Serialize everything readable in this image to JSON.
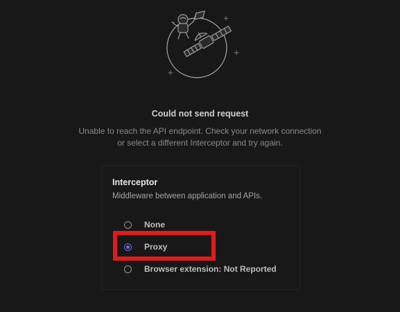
{
  "error": {
    "title": "Could not send request",
    "message_line1": "Unable to reach the API endpoint. Check your network connection",
    "message_line2": "or select a different Interceptor and try again."
  },
  "interceptor": {
    "title": "Interceptor",
    "subtitle": "Middleware between application and APIs.",
    "selected": "Proxy",
    "options": [
      {
        "label": "None",
        "checked": false
      },
      {
        "label": "Proxy",
        "checked": true
      },
      {
        "label": "Browser extension: Not Reported",
        "checked": false
      }
    ]
  },
  "illustration": {
    "icon": "astronaut-satellite-illustration"
  },
  "colors": {
    "background": "#181818",
    "accent": "#6f6ce6",
    "highlight": "#e01b1b"
  }
}
